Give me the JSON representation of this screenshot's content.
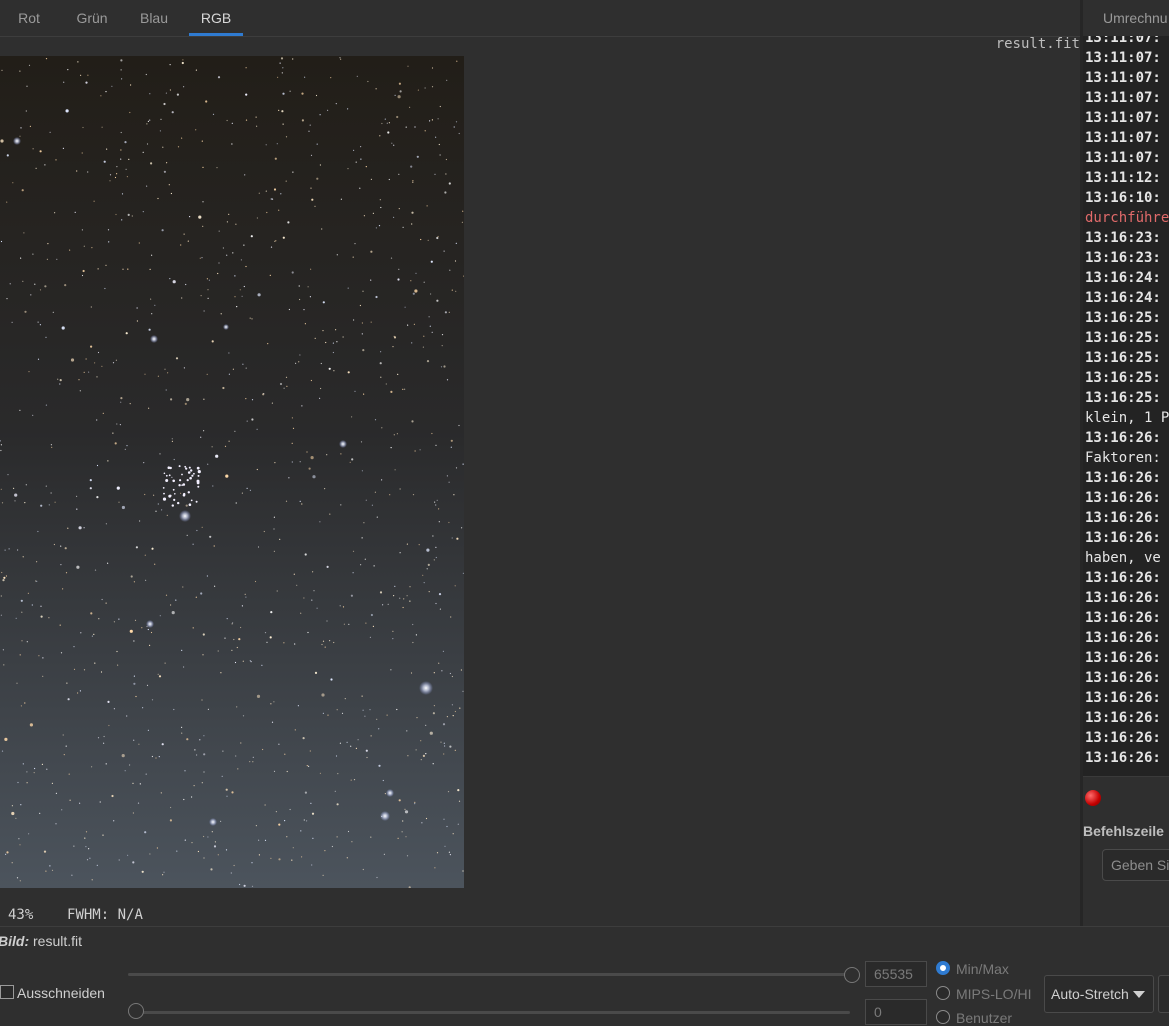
{
  "tabs": [
    "Rot",
    "Grün",
    "Blau",
    "RGB"
  ],
  "active_tab": "RGB",
  "image": {
    "filename": "result.fit"
  },
  "status": {
    "zoom": "43%",
    "fwhm": "FWHM: N/A"
  },
  "console": {
    "tab_label": "Umrechnu",
    "lines": [
      {
        "text": "13:11:07:",
        "kind": "time",
        "partial": true
      },
      {
        "text": "13:11:07:",
        "kind": "time"
      },
      {
        "text": "13:11:07:",
        "kind": "time"
      },
      {
        "text": "13:11:07:",
        "kind": "time"
      },
      {
        "text": "13:11:07:",
        "kind": "time"
      },
      {
        "text": "13:11:07:",
        "kind": "time"
      },
      {
        "text": "13:11:07:",
        "kind": "time"
      },
      {
        "text": "13:11:12:",
        "kind": "time"
      },
      {
        "text": "13:16:10:",
        "kind": "time"
      },
      {
        "text": "durchführe",
        "kind": "err"
      },
      {
        "text": "13:16:23:",
        "kind": "time"
      },
      {
        "text": "13:16:23:",
        "kind": "time"
      },
      {
        "text": "13:16:24:",
        "kind": "time"
      },
      {
        "text": "13:16:24:",
        "kind": "time"
      },
      {
        "text": "13:16:25:",
        "kind": "time"
      },
      {
        "text": "13:16:25:",
        "kind": "time"
      },
      {
        "text": "13:16:25:",
        "kind": "time"
      },
      {
        "text": "13:16:25:",
        "kind": "time"
      },
      {
        "text": "13:16:25:",
        "kind": "time"
      },
      {
        "text": "klein, 1 P",
        "kind": "plain"
      },
      {
        "text": "13:16:26:",
        "kind": "time"
      },
      {
        "text": "Faktoren:",
        "kind": "plain"
      },
      {
        "text": "13:16:26:",
        "kind": "time"
      },
      {
        "text": "13:16:26:",
        "kind": "time"
      },
      {
        "text": "13:16:26:",
        "kind": "time"
      },
      {
        "text": "13:16:26:",
        "kind": "time"
      },
      {
        "text": "haben, ve",
        "kind": "plain"
      },
      {
        "text": "13:16:26:",
        "kind": "time"
      },
      {
        "text": "13:16:26:",
        "kind": "time"
      },
      {
        "text": "13:16:26:",
        "kind": "time"
      },
      {
        "text": "13:16:26:",
        "kind": "time"
      },
      {
        "text": "13:16:26:",
        "kind": "time"
      },
      {
        "text": "13:16:26:",
        "kind": "time"
      },
      {
        "text": "13:16:26:",
        "kind": "time"
      },
      {
        "text": "13:16:26:",
        "kind": "time"
      },
      {
        "text": "13:16:26:",
        "kind": "time"
      },
      {
        "text": "13:16:26:",
        "kind": "time"
      }
    ],
    "command_label": "Befehlszeile",
    "command_placeholder": "Geben Si"
  },
  "bottom": {
    "bild_label": "Bild:",
    "bild_value": "result.fit",
    "crop_label": "Ausschneiden",
    "high_value": "65535",
    "low_value": "0",
    "high_level": 1.0,
    "low_level": 0.0,
    "radio_options": [
      "Min/Max",
      "MIPS-LO/HI",
      "Benutzer"
    ],
    "radio_selected": "Min/Max",
    "stretch_mode": "Auto-Stretch"
  },
  "colors": {
    "accent": "#2f7bd1",
    "error_text": "#e06a6a",
    "led": "#d00000"
  }
}
